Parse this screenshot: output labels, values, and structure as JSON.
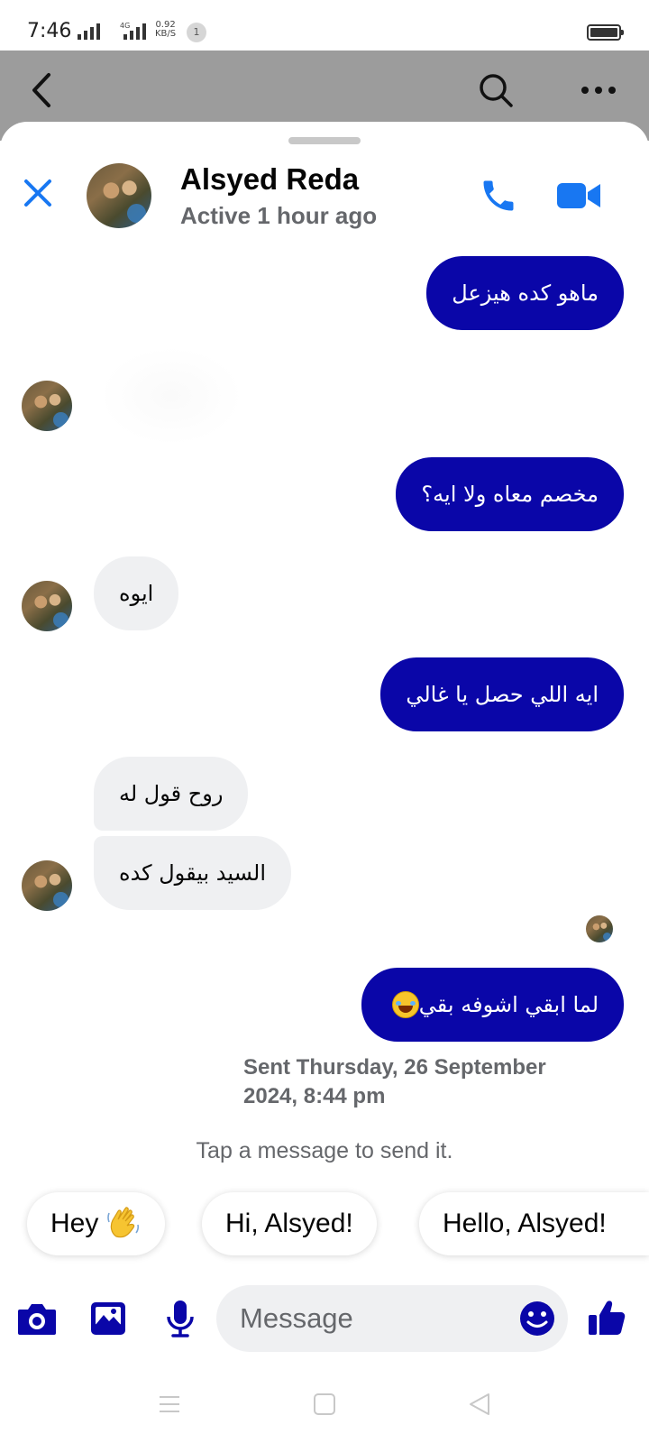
{
  "status_bar": {
    "time": "7:46",
    "network": "4G",
    "speed_value": "0.92",
    "speed_unit": "KB/S",
    "notification_count": "1"
  },
  "contact": {
    "name": "Alsyed Reda",
    "status": "Active 1 hour ago"
  },
  "messages": [
    {
      "direction": "outgoing",
      "text": "ماهو كده هيزعل"
    },
    {
      "direction": "incoming",
      "type": "sticker"
    },
    {
      "direction": "outgoing",
      "text": "مخصم معاه ولا ايه؟"
    },
    {
      "direction": "incoming",
      "text": "ايوه"
    },
    {
      "direction": "outgoing",
      "text": "ايه اللي حصل يا غالي"
    },
    {
      "direction": "incoming",
      "text": "روح قول له"
    },
    {
      "direction": "incoming",
      "text": "السيد بيقول كده"
    },
    {
      "direction": "outgoing",
      "text": "لما ابقي اشوفه بقي",
      "emoji": "face-with-tears-of-joy"
    }
  ],
  "sent_info": "Sent Thursday, 26 September 2024, 8:44 pm",
  "tap_hint": "Tap a message to send it.",
  "quick_replies": [
    {
      "label": "Hey",
      "emoji": "waving-hand"
    },
    {
      "label": "Hi, Alsyed!"
    },
    {
      "label": "Hello, Alsyed!"
    }
  ],
  "composer": {
    "placeholder": "Message"
  },
  "colors": {
    "outgoing_bubble": "#0a06a8",
    "incoming_bubble": "#eff0f2",
    "accent_blue": "#1877f2",
    "composer_icon": "#0a06a8",
    "secondary_text": "#65676b"
  },
  "icons": [
    "back-icon",
    "search-icon",
    "more-icon",
    "close-icon",
    "phone-icon",
    "video-icon",
    "camera-icon",
    "image-icon",
    "microphone-icon",
    "emoji-icon",
    "thumbs-up-icon",
    "menu-icon",
    "home-icon",
    "back-triangle-icon"
  ]
}
